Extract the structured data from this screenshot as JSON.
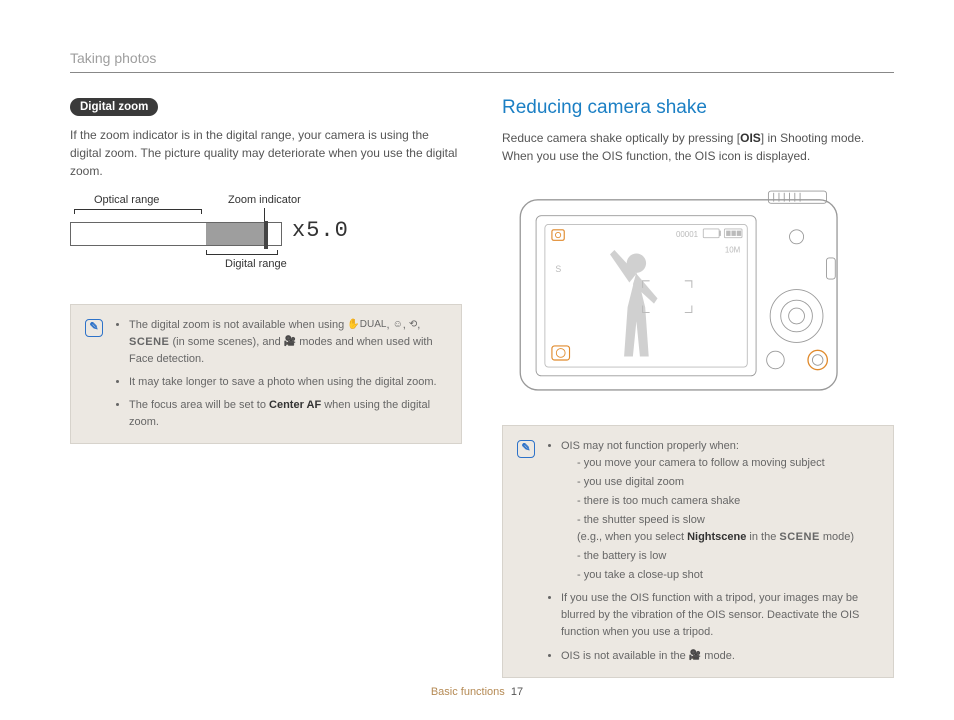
{
  "header": {
    "section": "Taking photos"
  },
  "left": {
    "pill": "Digital zoom",
    "intro": "If the zoom indicator is in the digital range, your camera is using the digital zoom. The picture quality may deteriorate when you use the digital zoom.",
    "diagram": {
      "optical_label": "Optical range",
      "zoom_indicator_label": "Zoom indicator",
      "digital_label": "Digital range",
      "zoom_text": "x5.0"
    },
    "note": {
      "b1_pre": "The digital zoom is not available when using ",
      "b1_mid": " (in some scenes), and ",
      "b1_post": " modes and when used with Face detection.",
      "b2": "It may take longer to save a photo when using the digital zoom.",
      "b3_pre": "The focus area will be set to ",
      "b3_bold": "Center AF",
      "b3_post": " when using the digital zoom."
    },
    "icons": {
      "hand_dual": "✋DUAL",
      "beauty": "☺",
      "guide": "⟲",
      "scene": "SCENE",
      "movie": "🎥"
    }
  },
  "right": {
    "heading": "Reducing camera shake",
    "intro_pre": "Reduce camera shake optically by pressing [",
    "intro_bold": "OIS",
    "intro_post": "] in Shooting mode. When you use the OIS function, the OIS icon is displayed.",
    "lcd": {
      "top_right": "00001",
      "res": "10M"
    },
    "note": {
      "b1": "OIS may not function properly when:",
      "d1": "you move your camera to follow a moving subject",
      "d2": "you use digital zoom",
      "d3": "there is too much camera shake",
      "d4": "the shutter speed is slow",
      "d4b_pre": "(e.g., when you select ",
      "d4b_bold": "Nightscene",
      "d4b_mid": " in the ",
      "d4b_scene": "SCENE",
      "d4b_post": " mode)",
      "d5": "the battery is low",
      "d6": "you take a close-up shot",
      "b2": "If you use the OIS function with a tripod, your images may be blurred by the vibration of the OIS sensor. Deactivate the OIS function when you use a tripod.",
      "b3_pre": "OIS is not available in the ",
      "b3_post": " mode."
    }
  },
  "footer": {
    "label": "Basic functions",
    "page": "17"
  }
}
